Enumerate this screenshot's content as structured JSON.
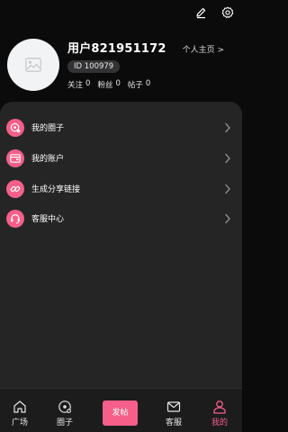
{
  "header": {
    "username": "用户821951172",
    "id_label": "ID 100979",
    "homepage_link": "个人主页 >",
    "stats": [
      {
        "label": "关注",
        "value": "0"
      },
      {
        "label": "粉丝",
        "value": "0"
      },
      {
        "label": "帖子",
        "value": "0"
      }
    ],
    "icons": [
      "edit-icon",
      "settings-icon"
    ]
  },
  "menu": {
    "items": [
      {
        "label": "我的圈子",
        "icon": "circle-group-icon"
      },
      {
        "label": "我的账户",
        "icon": "wallet-icon"
      },
      {
        "label": "生成分享链接",
        "icon": "link-icon"
      },
      {
        "label": "客服中心",
        "icon": "headset-icon"
      }
    ]
  },
  "tabbar": {
    "tabs": [
      {
        "label": "广场",
        "icon": "home-icon"
      },
      {
        "label": "圈子",
        "icon": "circle-icon"
      },
      {
        "label": "发帖",
        "icon": "post-button"
      },
      {
        "label": "客服",
        "icon": "mail-icon"
      },
      {
        "label": "我的",
        "icon": "user-icon",
        "active": true
      }
    ]
  },
  "colors": {
    "accent": "#f65f8a",
    "background": "#0b0b0c",
    "card": "#252526"
  }
}
